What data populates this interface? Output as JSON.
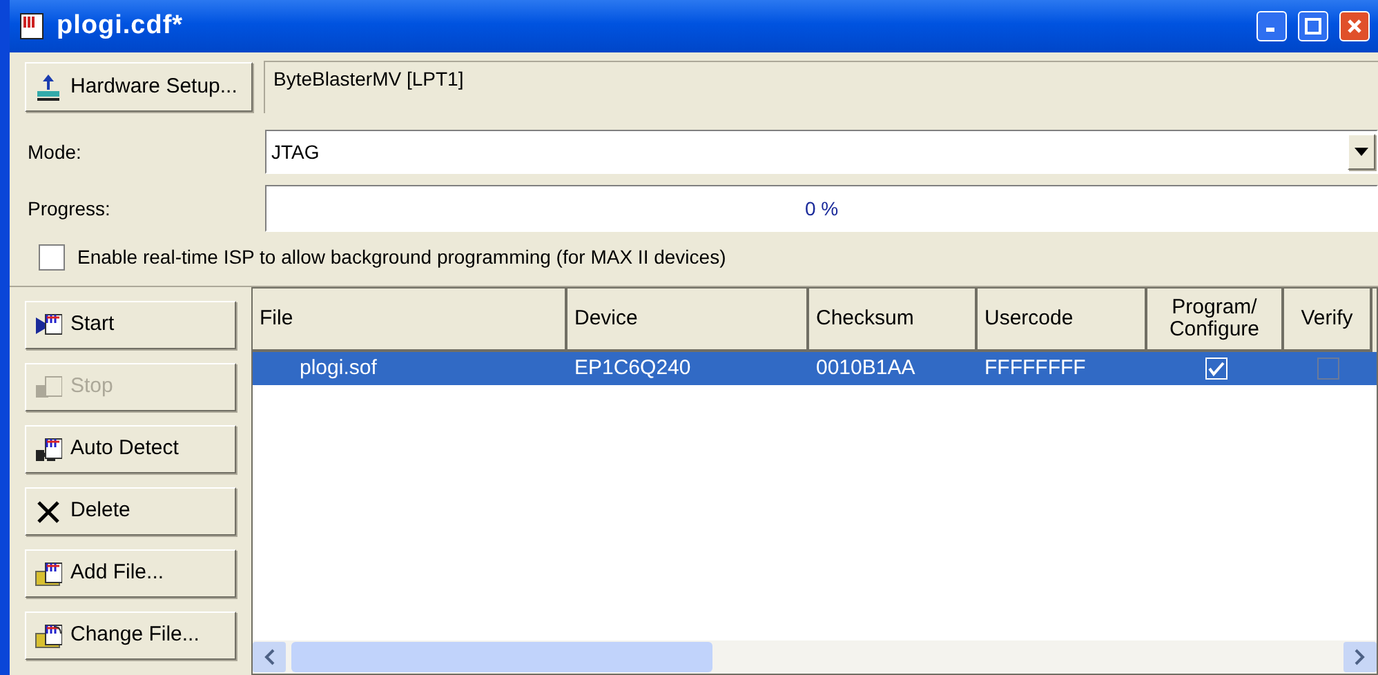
{
  "window": {
    "title": "plogi.cdf*"
  },
  "hardware": {
    "button": "Hardware Setup...",
    "value": "ByteBlasterMV [LPT1]"
  },
  "mode": {
    "label": "Mode:",
    "value": "JTAG"
  },
  "progress": {
    "label": "Progress:",
    "reading": "0 %"
  },
  "isp": {
    "label": "Enable real-time ISP to allow background programming (for MAX II devices)",
    "checked": false
  },
  "buttons": [
    {
      "label": "Start",
      "disabled": false
    },
    {
      "label": "Stop",
      "disabled": true
    },
    {
      "label": "Auto Detect",
      "disabled": false
    },
    {
      "label": "Delete",
      "disabled": false
    },
    {
      "label": "Add File...",
      "disabled": false
    },
    {
      "label": "Change File...",
      "disabled": false
    }
  ],
  "table": {
    "columns": [
      "File",
      "Device",
      "Checksum",
      "Usercode",
      "Program/ Configure",
      "Verify"
    ],
    "rows": [
      {
        "selected": true,
        "file": "plogi.sof",
        "device": "EP1C6Q240",
        "checksum": "0010B1AA",
        "usercode": "FFFFFFFF",
        "program": true,
        "verify": false
      }
    ]
  }
}
